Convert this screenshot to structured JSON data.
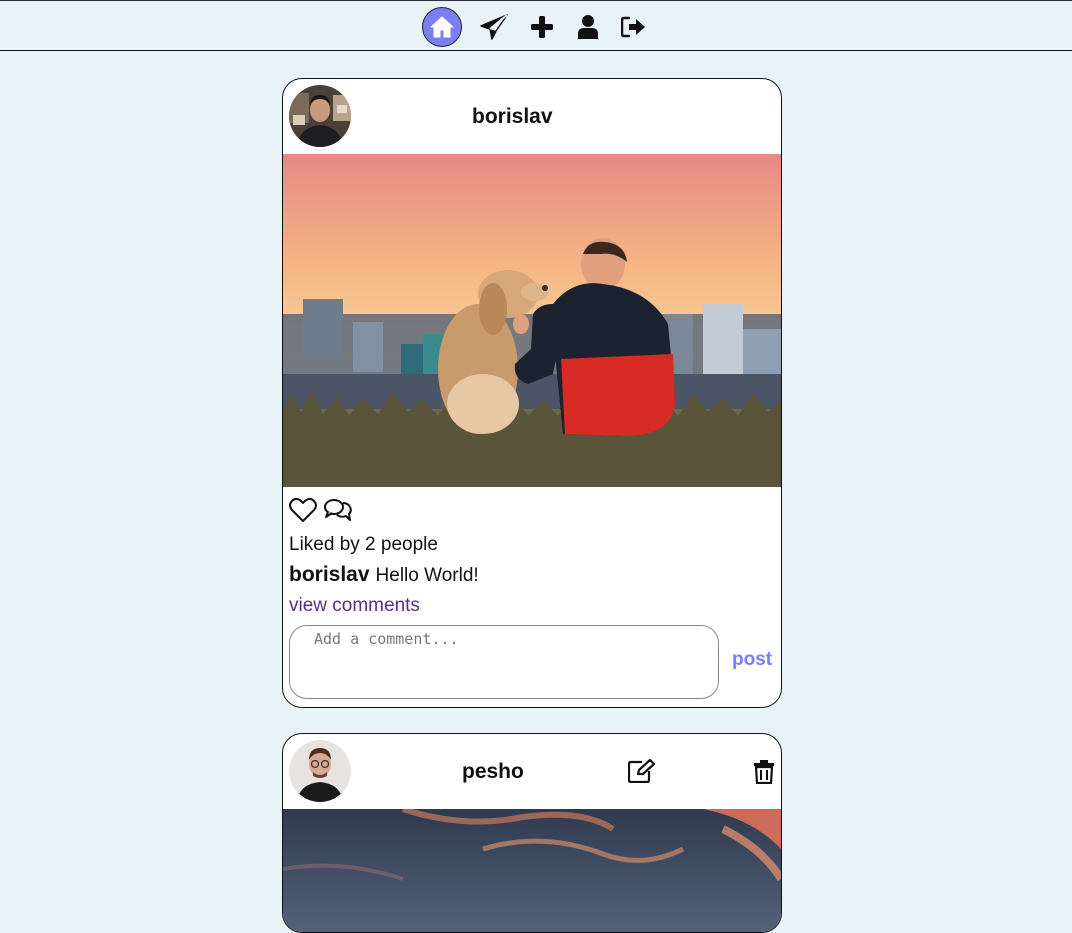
{
  "nav": {
    "items": [
      {
        "name": "home-icon",
        "active": true
      },
      {
        "name": "send-icon"
      },
      {
        "name": "plus-icon"
      },
      {
        "name": "user-icon"
      },
      {
        "name": "logout-icon"
      }
    ]
  },
  "posts": [
    {
      "username": "borislav",
      "likes_text": "Liked by 2 people",
      "caption_user": "borislav",
      "caption_text": "Hello World!",
      "view_comments": "view comments",
      "comment_placeholder": "Add a comment...",
      "post_label": "post"
    },
    {
      "username": "pesho"
    }
  ],
  "colors": {
    "background": "#e8f3f8",
    "accent": "#7b7ef5",
    "link": "#5a2d8c"
  }
}
